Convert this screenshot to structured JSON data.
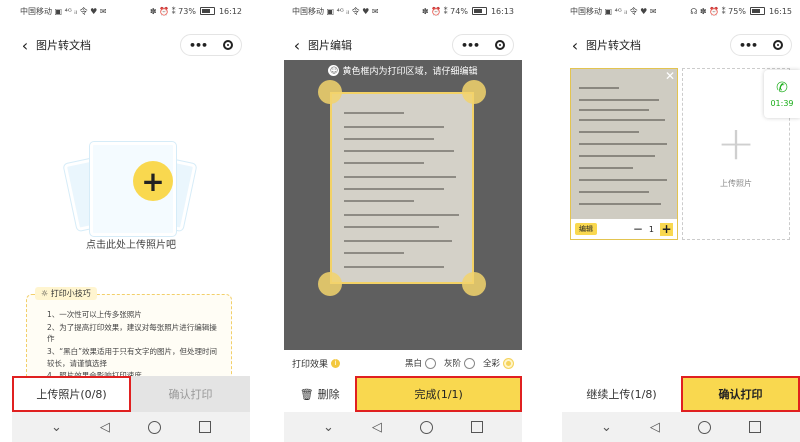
{
  "screens": [
    {
      "status": {
        "left": "中国移动 ▣ ⁴ᴳ ᵢₗ 令 ♥ ✉",
        "right": "✽ ⏰ ⁑ 73%",
        "time": "16:12"
      },
      "title": "图片转文档",
      "hint": "点击此处上传照片吧",
      "tips": {
        "title": "打印小技巧",
        "items": [
          "1、一次性可以上传多张照片",
          "2、为了提高打印效果，建议对每张照片进行编辑操作",
          "3、“黑白”效果适用于只有文字的图片，但处理时间较长，请谨慎选择",
          "4、照片效果会影响打印速度"
        ]
      },
      "buttons": {
        "upload": "上传照片(0/8)",
        "confirm": "确认打印"
      }
    },
    {
      "status": {
        "left": "中国移动 ▣ ⁴ᴳ ᵢₗ 令 ♥ ✉",
        "right": "✽ ⏰ ⁑ 74%",
        "time": "16:13"
      },
      "title": "图片编辑",
      "tip": "黄色框内为打印区域，请仔细编辑",
      "effects": {
        "label": "打印效果",
        "options": [
          "黑白",
          "灰阶",
          "全彩"
        ]
      },
      "buttons": {
        "delete": "删除",
        "done": "完成(1/1)"
      }
    },
    {
      "status": {
        "left": "中国移动 ▣ ⁴ᴳ ᵢₗ 令 ♥ ✉",
        "right": "☊ ✽ ⏰ ⁑ 75%",
        "time": "16:15"
      },
      "title": "图片转文档",
      "thumb": {
        "tag": "编辑",
        "qty": "1"
      },
      "upload_label": "上传照片",
      "call_time": "01:39",
      "buttons": {
        "continue": "继续上传(1/8)",
        "print": "确认打印"
      }
    }
  ],
  "colors": {
    "accent": "#f9d84f",
    "highlight": "#e02020",
    "call": "#1aad19"
  }
}
